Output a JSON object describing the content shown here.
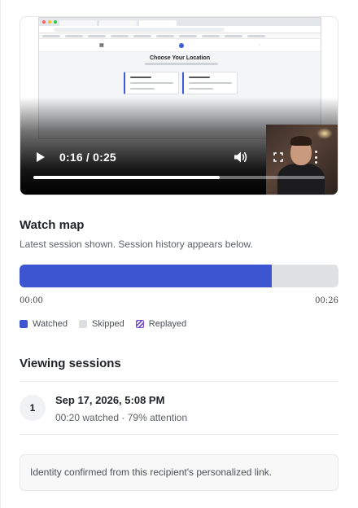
{
  "video": {
    "time_display": "0:16 / 0:25",
    "progress_fraction": 0.64,
    "recorded_page": {
      "heading": "Choose Your Location"
    }
  },
  "watch_map": {
    "title": "Watch map",
    "subtitle": "Latest session shown. Session history appears below.",
    "watched_fraction": 0.79,
    "start_label": "00:00",
    "end_label": "00:26",
    "legend": {
      "watched": "Watched",
      "skipped": "Skipped",
      "replayed": "Replayed"
    },
    "colors": {
      "watched": "#3d55d1",
      "skipped": "#dcdee1",
      "replayed": "#7a4bd0"
    }
  },
  "sessions": {
    "title": "Viewing sessions",
    "items": [
      {
        "index": "1",
        "date": "Sep 17, 2026, 5:08 PM",
        "meta": "00:20 watched · 79% attention"
      }
    ]
  },
  "identity_note": "Identity confirmed from this recipient's personalized link."
}
